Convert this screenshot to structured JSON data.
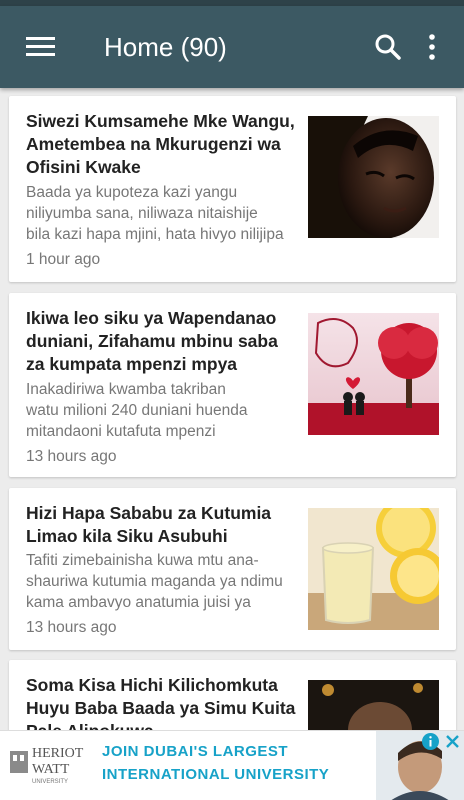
{
  "app_bar": {
    "title": "Home (90)",
    "menu_icon": "hamburger-menu-icon",
    "search_icon": "search-icon",
    "more_icon": "more-vert-icon",
    "color": "#3c5963"
  },
  "articles": [
    {
      "title": "Siwezi Kumsamehe Mke Wangu, Ametembea na Mkurugenzi wa Ofisini Kwake",
      "snippet": [
        "Baada ya kupoteza kazi yangu",
        "niliyumba sana, niliwaza nitaishije",
        "bila kazi hapa mjini, hata hivyo nilijipa"
      ],
      "time": "1 hour ago"
    },
    {
      "title": "Ikiwa leo siku ya Wapendanao duniani, Zifahamu mbinu saba za kumpata mpenzi mpya",
      "snippet": [
        "Inakadiriwa kwamba takriban",
        "watu milioni 240 duniani huenda",
        "mitandaoni kutafuta mpenzi"
      ],
      "time": "13 hours ago"
    },
    {
      "title": "Hizi Hapa Sababu za Kutumia Limao kila Siku Asubuhi",
      "snippet": [
        "Tafiti zimebainisha kuwa mtu ana-",
        "shauriwa kutumia maganda ya ndimu",
        "kama ambavyo anatumia juisi ya"
      ],
      "time": "13 hours ago"
    },
    {
      "title": "Soma Kisa Hichi Kilichomkuta Huyu Baba Baada ya Simu Kuita Pale Alipokuwa",
      "snippet": [],
      "time": ""
    }
  ],
  "ad": {
    "brand_line1": "HERIOT",
    "brand_line2": "WATT",
    "brand_line3": "UNIVERSITY",
    "line1": "JOIN DUBAI'S LARGEST",
    "line2": "INTERNATIONAL UNIVERSITY",
    "accent": "#17a2c8"
  }
}
